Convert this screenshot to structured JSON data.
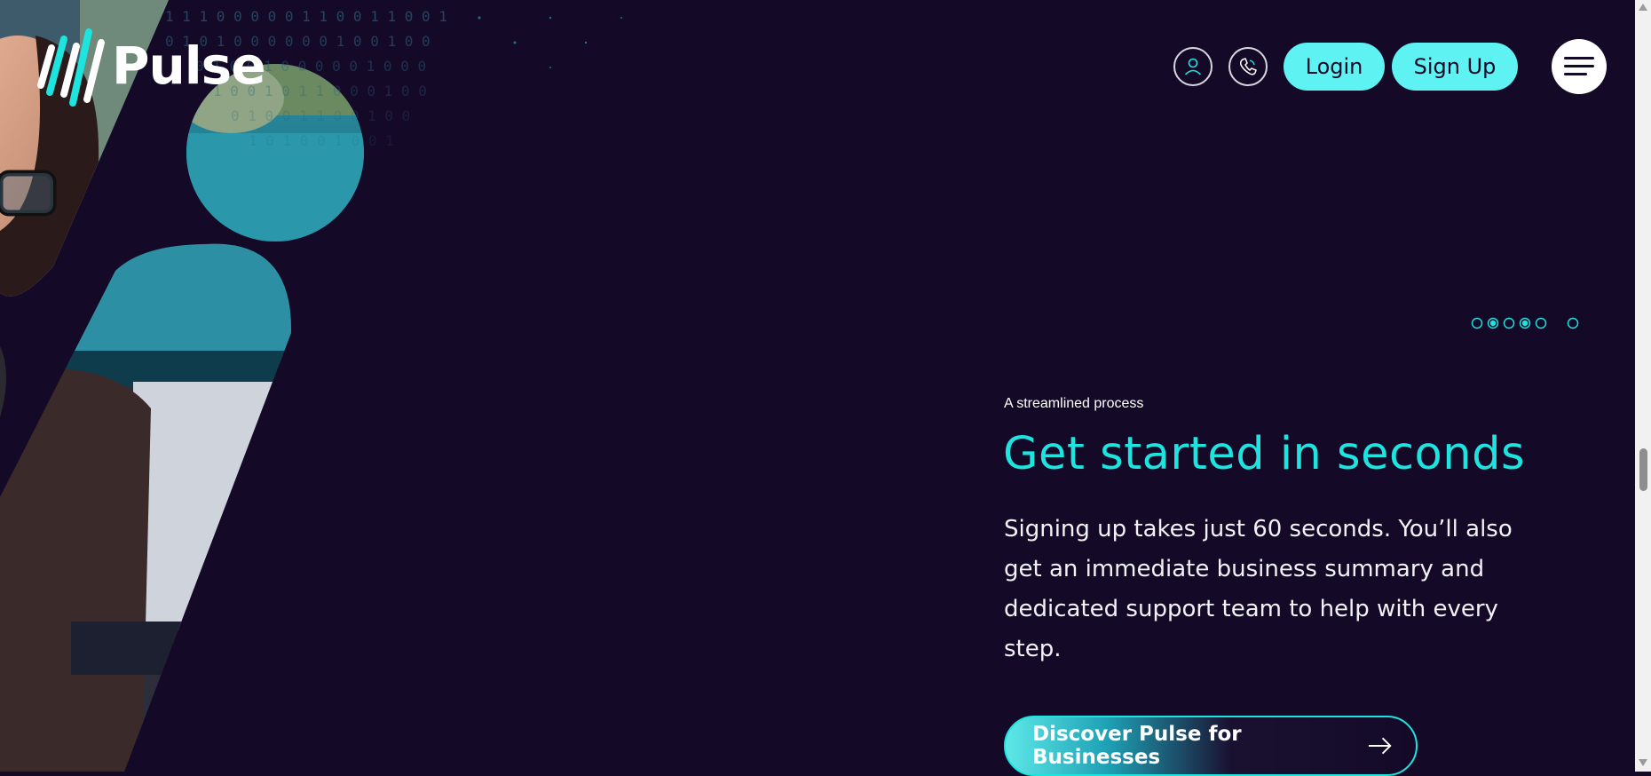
{
  "brand": {
    "name": "Pulse",
    "logo_icon": "pulse-bars-icon",
    "accent": "#1ee4df",
    "button_color": "#5ef2f2",
    "background": "#140a28"
  },
  "header": {
    "account_icon": "user-icon",
    "phone_icon": "phone-icon",
    "login_label": "Login",
    "signup_label": "Sign Up",
    "menu_icon": "hamburger-menu-icon"
  },
  "slider": {
    "dot_count": 6,
    "active_dots": [
      2,
      4
    ]
  },
  "hero": {
    "eyebrow": "A streamlined process",
    "headline": "Get started in seconds",
    "body": "Signing up takes just 60 seconds. You’ll also get an immediate business summary and dedicated support team to help with every step.",
    "cta_label": "Discover Pulse for Businesses",
    "cta_icon": "arrow-right-icon"
  }
}
